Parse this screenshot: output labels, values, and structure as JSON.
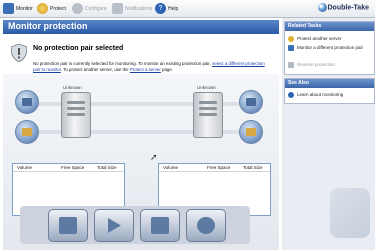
{
  "toolbar": {
    "items": [
      {
        "label": "Monitor",
        "icon": "monitor-icon",
        "color": "#3b6fb5",
        "enabled": true
      },
      {
        "label": "Protect",
        "icon": "shield-icon",
        "color": "#e0b030",
        "enabled": true
      },
      {
        "label": "Configure",
        "icon": "configure-icon",
        "color": "#a9b2bd",
        "enabled": false
      },
      {
        "label": "Notifications",
        "icon": "notifications-icon",
        "color": "#a9b2bd",
        "enabled": false
      },
      {
        "label": "Help",
        "icon": "help-icon",
        "color": "#2c63b3",
        "enabled": true
      }
    ],
    "logo": "Double-Take"
  },
  "main": {
    "title": "Monitor protection",
    "message_title": "No protection pair selected",
    "message_text_1": "No protection pair is currently selected for monitoring. To monitor an existing protection pair, ",
    "message_link_1": "select a different protection pair to monitor",
    "message_text_2": ". To protect another server, use the ",
    "message_link_2": "Protect a server",
    "message_text_3": " page.",
    "left_server_label": "Unknown",
    "right_server_label": "Unknown",
    "table_columns": [
      "Volume",
      "Free Space",
      "Total Size"
    ]
  },
  "sidebar": {
    "related_tasks_title": "Related Tasks",
    "tasks": [
      {
        "label": "Protect another server",
        "enabled": true
      },
      {
        "label": "Monitor a different protection pair",
        "enabled": true
      },
      {
        "label": "Reverse protection",
        "enabled": false
      }
    ],
    "see_also_title": "See Also",
    "see_also": [
      {
        "label": "Learn about monitoring"
      }
    ]
  },
  "colors": {
    "title_bar": "#2a5aa8",
    "accent": "#3d67ab",
    "link": "#1a3fa6"
  }
}
